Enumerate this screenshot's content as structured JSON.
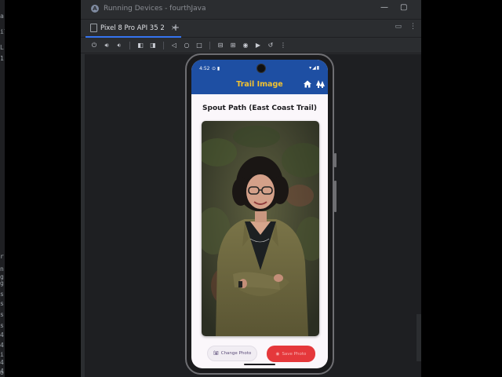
{
  "window": {
    "title": "Running Devices - fourthJava"
  },
  "tabs": [
    {
      "label": "Pixel 8 Pro API 35 2"
    }
  ],
  "gutter_chars": [
    "a",
    "il",
    "L",
    "1",
    "r",
    "n",
    "g",
    "g",
    "s",
    "s",
    "s",
    "s",
    "4",
    "4",
    "i",
    "4",
    "4",
    "o"
  ],
  "device": {
    "status": {
      "time": "4:52"
    },
    "app_bar": {
      "title": "Trail Image"
    },
    "heading": "Spout Path (East Coast Trail)",
    "buttons": {
      "change_photo": "Change Photo",
      "primary": "Save Photo"
    }
  },
  "colors": {
    "app_bar": "#1e4fa3",
    "app_title": "#f2c230",
    "primary_button": "#e5383b",
    "ide_bg": "#2b2d30"
  }
}
